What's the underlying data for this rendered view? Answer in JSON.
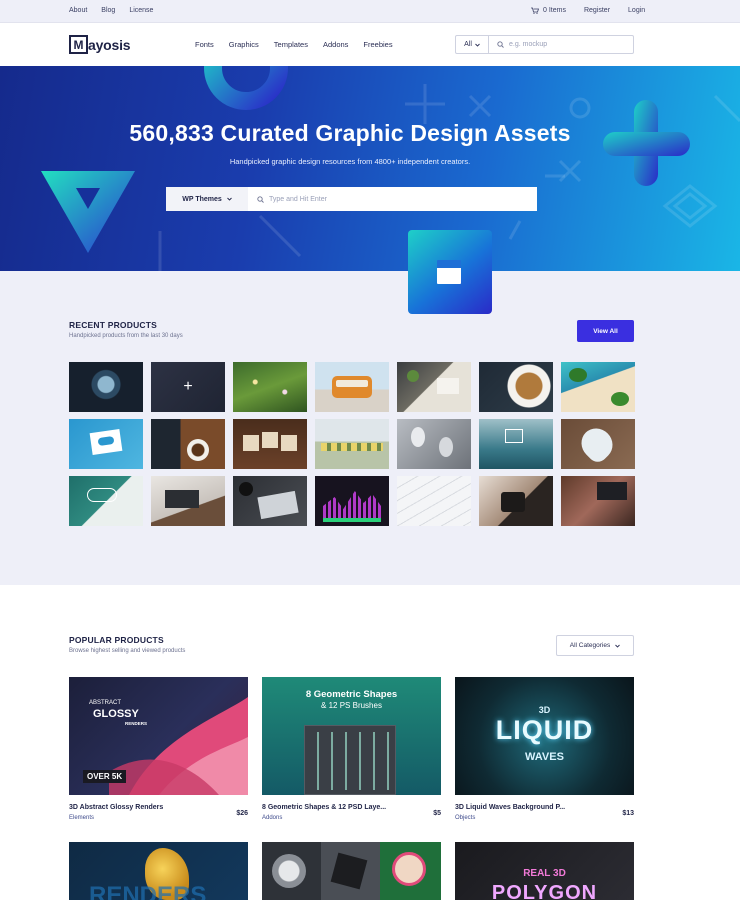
{
  "topbar": {
    "links": [
      "About",
      "Blog",
      "License"
    ],
    "cart_label": "0 Items",
    "register": "Register",
    "login": "Login"
  },
  "header": {
    "logo_letter": "M",
    "logo_text": "ayosis",
    "nav": [
      "Fonts",
      "Graphics",
      "Templates",
      "Addons",
      "Freebies"
    ],
    "search_select": "All",
    "search_placeholder": "e.g. mockup"
  },
  "hero": {
    "title": "560,833 Curated Graphic Design Assets",
    "subtitle": "Handpicked graphic design resources from 4800+ independent creators.",
    "search_select": "WP Themes",
    "search_placeholder": "Type and Hit Enter"
  },
  "recent": {
    "title": "RECENT PRODUCTS",
    "subtitle": "Handpicked products from the last 30 days",
    "view_all": "View All",
    "thumbs": [
      "lens",
      "plus",
      "grass",
      "bus",
      "desk-plants",
      "coffee-cup",
      "palm-beach",
      "cloud-card",
      "coffee-table",
      "seo-tiles",
      "flowers",
      "lightbulbs",
      "ocean-hand",
      "heart-tag",
      "sketch",
      "laptop-desk",
      "tablet-desk",
      "equalizer",
      "keyboard",
      "camera",
      "workspace"
    ]
  },
  "popular": {
    "title": "POPULAR PRODUCTS",
    "subtitle": "Browse highest selling and viewed products",
    "filter": "All Categories",
    "cards": [
      {
        "name": "3D Abstract Glossy Renders",
        "category": "Elements",
        "price": "$26",
        "art": {
          "l1": "ABSTRACT",
          "l2": "GLOSSY",
          "l3": "RENDERS",
          "badge": "OVER 5K"
        }
      },
      {
        "name": "8 Geometric Shapes & 12 PSD Laye...",
        "category": "Addons",
        "price": "$5",
        "art": {
          "l1": "8 Geometric Shapes",
          "l2": "& 12 PS Brushes"
        }
      },
      {
        "name": "3D Liquid Waves Background P...",
        "category": "Objects",
        "price": "$13",
        "art": {
          "l1": "3D",
          "l2": "LIQUID",
          "l3": "WAVES"
        }
      }
    ],
    "row2_art": {
      "left": "RENDERS",
      "right_l1": "REAL 3D",
      "right_l2": "POLYGON"
    }
  },
  "colors": {
    "accent": "#3a2fe0",
    "hero_start": "#152a8c",
    "hero_end": "#1ab6e6",
    "bg_soft": "#eeeff8"
  }
}
